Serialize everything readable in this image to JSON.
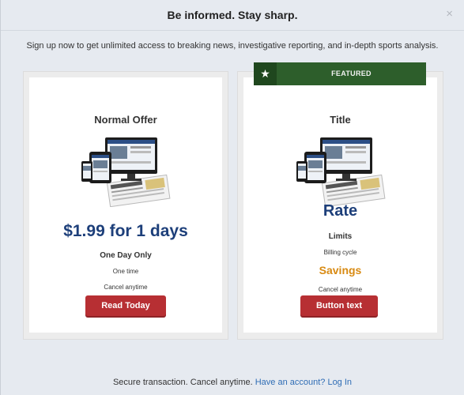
{
  "modal": {
    "title": "Be informed. Stay sharp.",
    "close_label": "×",
    "subhead": "Sign up now to get unlimited access to breaking news, investigative reporting, and in-depth sports analysis."
  },
  "offers": [
    {
      "title": "Normal Offer",
      "price": "$1.99 for 1 days",
      "line1": "One Day Only",
      "line2": "One time",
      "line3": "Cancel anytime",
      "button": "Read Today"
    },
    {
      "badge": "FEATURED",
      "badge_icon": "star-icon",
      "title": "Title",
      "rate": "Rate",
      "limits": "Limits",
      "billing": "Billing cycle",
      "savings": "Savings",
      "cancel": "Cancel anytime",
      "button": "Button text"
    }
  ],
  "footer": {
    "text": "Secure transaction. Cancel anytime.",
    "link": "Have an account? Log In"
  },
  "colors": {
    "accent_blue": "#1d3f7a",
    "button_red": "#b72f33",
    "featured_green": "#2d5e2b",
    "savings_orange": "#d88a12",
    "link_blue": "#2f6db5"
  }
}
